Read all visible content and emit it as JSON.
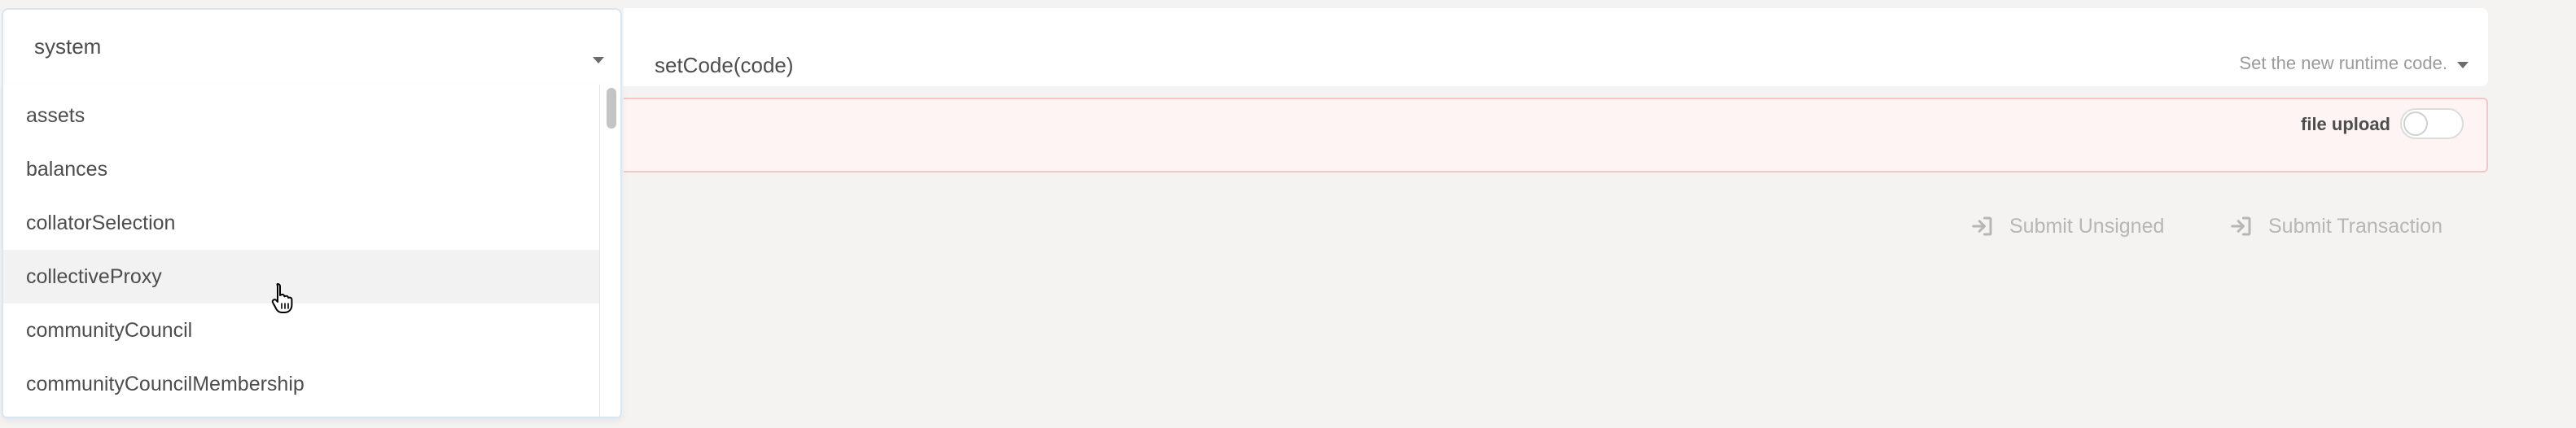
{
  "section_select": {
    "value": "system",
    "options": [
      "assets",
      "balances",
      "collatorSelection",
      "collectiveProxy",
      "communityCouncil",
      "communityCouncilMembership"
    ],
    "hovered_option": "collectiveProxy"
  },
  "method_select": {
    "method": "setCode(code)",
    "hint": "Set the new runtime code."
  },
  "param": {
    "file_upload_label": "file upload",
    "file_upload_enabled": false
  },
  "actions": {
    "submit_unsigned_label": "Submit Unsigned",
    "submit_transaction_label": "Submit Transaction"
  },
  "colors": {
    "page_background": "#f4f3f2",
    "error_background": "#fdf4f3",
    "error_border": "#f2c7c7",
    "disabled_text": "#b6b6b6",
    "selected_border": "#d6e6f4"
  }
}
